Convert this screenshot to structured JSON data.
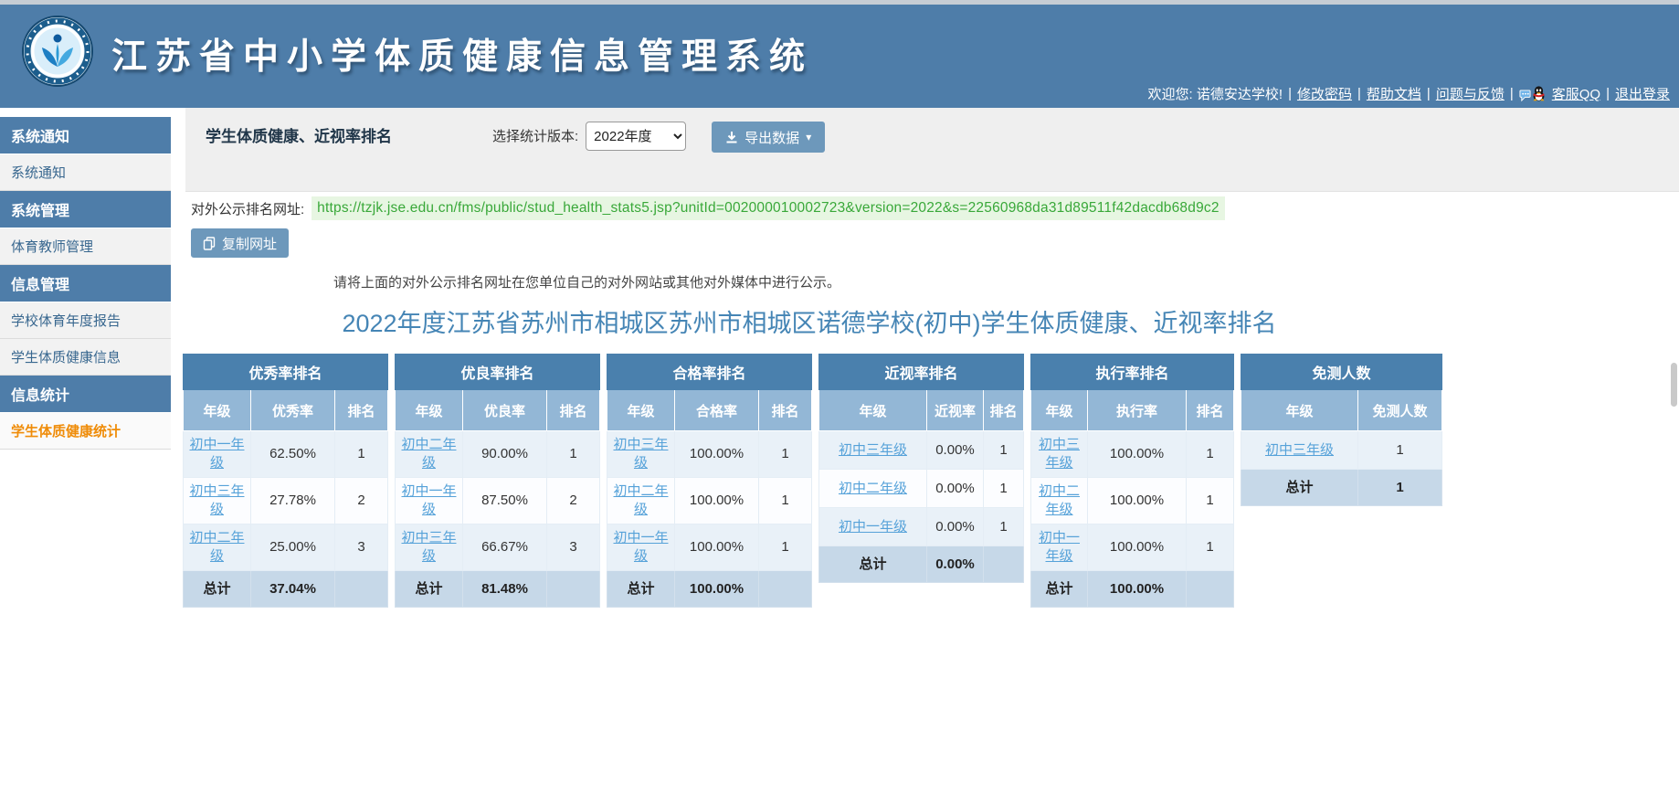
{
  "header": {
    "app_title": "江苏省中小学体质健康信息管理系统",
    "welcome": "欢迎您: 诺德安达学校!",
    "links": [
      "修改密码",
      "帮助文档",
      "问题与反馈",
      "客服QQ",
      "退出登录"
    ]
  },
  "sidebar": {
    "blocks": [
      {
        "type": "header",
        "label": "系统通知"
      },
      {
        "type": "item",
        "label": "系统通知"
      },
      {
        "type": "header",
        "label": "系统管理"
      },
      {
        "type": "item",
        "label": "体育教师管理"
      },
      {
        "type": "header",
        "label": "信息管理"
      },
      {
        "type": "item",
        "label": "学校体育年度报告"
      },
      {
        "type": "item",
        "label": "学生体质健康信息"
      },
      {
        "type": "header",
        "label": "信息统计"
      },
      {
        "type": "item",
        "label": "学生体质健康统计",
        "active": true
      }
    ]
  },
  "toolbar": {
    "page_title": "学生体质健康、近视率排名",
    "version_label": "选择统计版本:",
    "version_value": "2022年度",
    "export_label": "导出数据"
  },
  "publish": {
    "url_label": "对外公示排名网址:",
    "url": "https://tzjk.jse.edu.cn/fms/public/stud_health_stats5.jsp?unitId=002000010002723&version=2022&s=22560968da31d89511f42dacdb68d9c2",
    "copy_button": "复制网址",
    "note": "请将上面的对外公示排名网址在您单位自己的对外网站或其他对外媒体中进行公示。"
  },
  "main_title": "2022年度江苏省苏州市相城区苏州市相城区诺德学校(初中)学生体质健康、近视率排名",
  "tables": [
    {
      "title": "优秀率排名",
      "columns": [
        "年级",
        "优秀率",
        "排名"
      ],
      "rows": [
        [
          "初中一年级",
          "62.50%",
          "1"
        ],
        [
          "初中三年级",
          "27.78%",
          "2"
        ],
        [
          "初中二年级",
          "25.00%",
          "3"
        ]
      ],
      "total": [
        "总计",
        "37.04%",
        ""
      ]
    },
    {
      "title": "优良率排名",
      "columns": [
        "年级",
        "优良率",
        "排名"
      ],
      "rows": [
        [
          "初中二年级",
          "90.00%",
          "1"
        ],
        [
          "初中一年级",
          "87.50%",
          "2"
        ],
        [
          "初中三年级",
          "66.67%",
          "3"
        ]
      ],
      "total": [
        "总计",
        "81.48%",
        ""
      ]
    },
    {
      "title": "合格率排名",
      "columns": [
        "年级",
        "合格率",
        "排名"
      ],
      "rows": [
        [
          "初中三年级",
          "100.00%",
          "1"
        ],
        [
          "初中二年级",
          "100.00%",
          "1"
        ],
        [
          "初中一年级",
          "100.00%",
          "1"
        ]
      ],
      "total": [
        "总计",
        "100.00%",
        ""
      ]
    },
    {
      "title": "近视率排名",
      "columns": [
        "年级",
        "近视率",
        "排名"
      ],
      "rows": [
        [
          "初中三年级",
          "0.00%",
          "1"
        ],
        [
          "初中二年级",
          "0.00%",
          "1"
        ],
        [
          "初中一年级",
          "0.00%",
          "1"
        ]
      ],
      "total": [
        "总计",
        "0.00%",
        ""
      ]
    },
    {
      "title": "执行率排名",
      "columns": [
        "年级",
        "执行率",
        "排名"
      ],
      "rows": [
        [
          "初中三年级",
          "100.00%",
          "1"
        ],
        [
          "初中二年级",
          "100.00%",
          "1"
        ],
        [
          "初中一年级",
          "100.00%",
          "1"
        ]
      ],
      "total": [
        "总计",
        "100.00%",
        ""
      ]
    },
    {
      "title": "免测人数",
      "columns": [
        "年级",
        "免测人数"
      ],
      "rows": [
        [
          "初中三年级",
          "1"
        ]
      ],
      "total": [
        "总计",
        "1"
      ]
    }
  ],
  "colors": {
    "header_blue": "#4e7da9",
    "table_title_blue": "#4a80ad",
    "table_subheader_blue": "#93b7d6",
    "total_row_blue": "#c6d8e8",
    "row_pale_blue": "#e9f1f8",
    "active_item_orange": "#ef8c08",
    "link_blue": "#56a2d9",
    "url_green": "#39a839",
    "heading_blue": "#4585b5"
  }
}
